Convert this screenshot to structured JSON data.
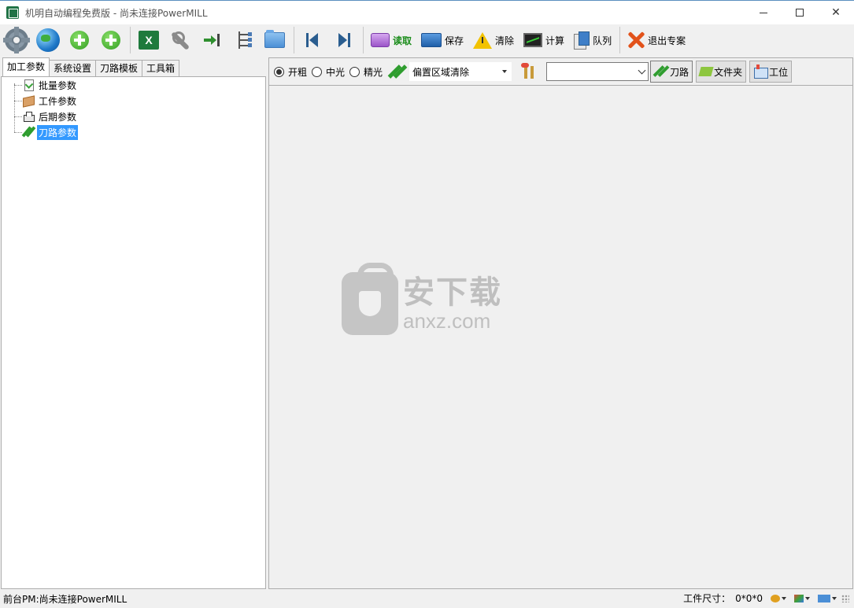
{
  "window": {
    "title": "机明自动编程免费版 - 尚未连接PowerMILL"
  },
  "toolbar": {
    "read_label": "读取",
    "save_label": "保存",
    "clear_label": "清除",
    "calc_label": "计算",
    "queue_label": "队列",
    "exit_label": "退出专案"
  },
  "left_tabs": [
    "加工参数",
    "系统设置",
    "刀路模板",
    "工具箱"
  ],
  "tree": {
    "items": [
      {
        "label": "批量参数",
        "icon": "batch-params-icon"
      },
      {
        "label": "工件参数",
        "icon": "part-params-icon"
      },
      {
        "label": "后期参数",
        "icon": "post-params-icon"
      },
      {
        "label": "刀路参数",
        "icon": "toolpath-params-icon",
        "selected": true
      }
    ]
  },
  "options": {
    "radios": [
      "开粗",
      "中光",
      "精光"
    ],
    "selected_radio": "开粗",
    "strategy_value": "偏置区域清除",
    "template_value": "",
    "btn_toolpath": "刀路",
    "btn_folder": "文件夹",
    "btn_station": "工位"
  },
  "watermark": {
    "cn": "安下载",
    "en": "anxz.com"
  },
  "status": {
    "left": "前台PM:尚未连接PowerMILL",
    "part_size_label": "工件尺寸：",
    "part_size_value": "0*0*0"
  },
  "colors": {
    "selection": "#3399ff",
    "read_label": "#1a8c1a"
  }
}
